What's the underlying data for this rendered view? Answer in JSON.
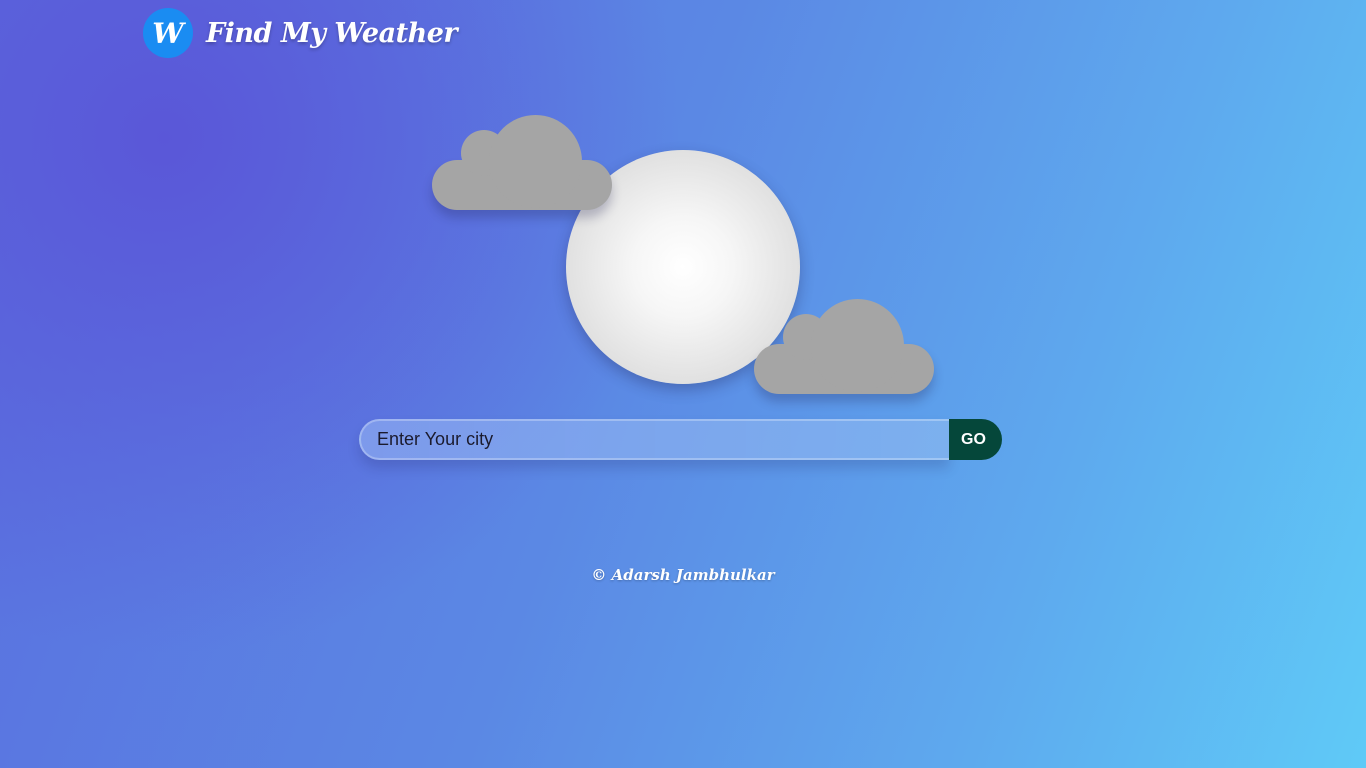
{
  "header": {
    "logo_letter": "W",
    "brand_title": "Find My Weather"
  },
  "illustration": {
    "icons": [
      "cloud-icon",
      "sun-icon",
      "cloud-icon"
    ]
  },
  "search": {
    "placeholder": "Enter Your city",
    "value": "",
    "button_label": "GO"
  },
  "footer": {
    "copyright": "© Adarsh Jambhulkar"
  },
  "colors": {
    "logo_bg": "#1a8cf2",
    "go_button_bg": "#05473a",
    "cloud": "#a5a5a5",
    "gradient_start": "#5a57d8",
    "gradient_end": "#5fcaf7"
  }
}
